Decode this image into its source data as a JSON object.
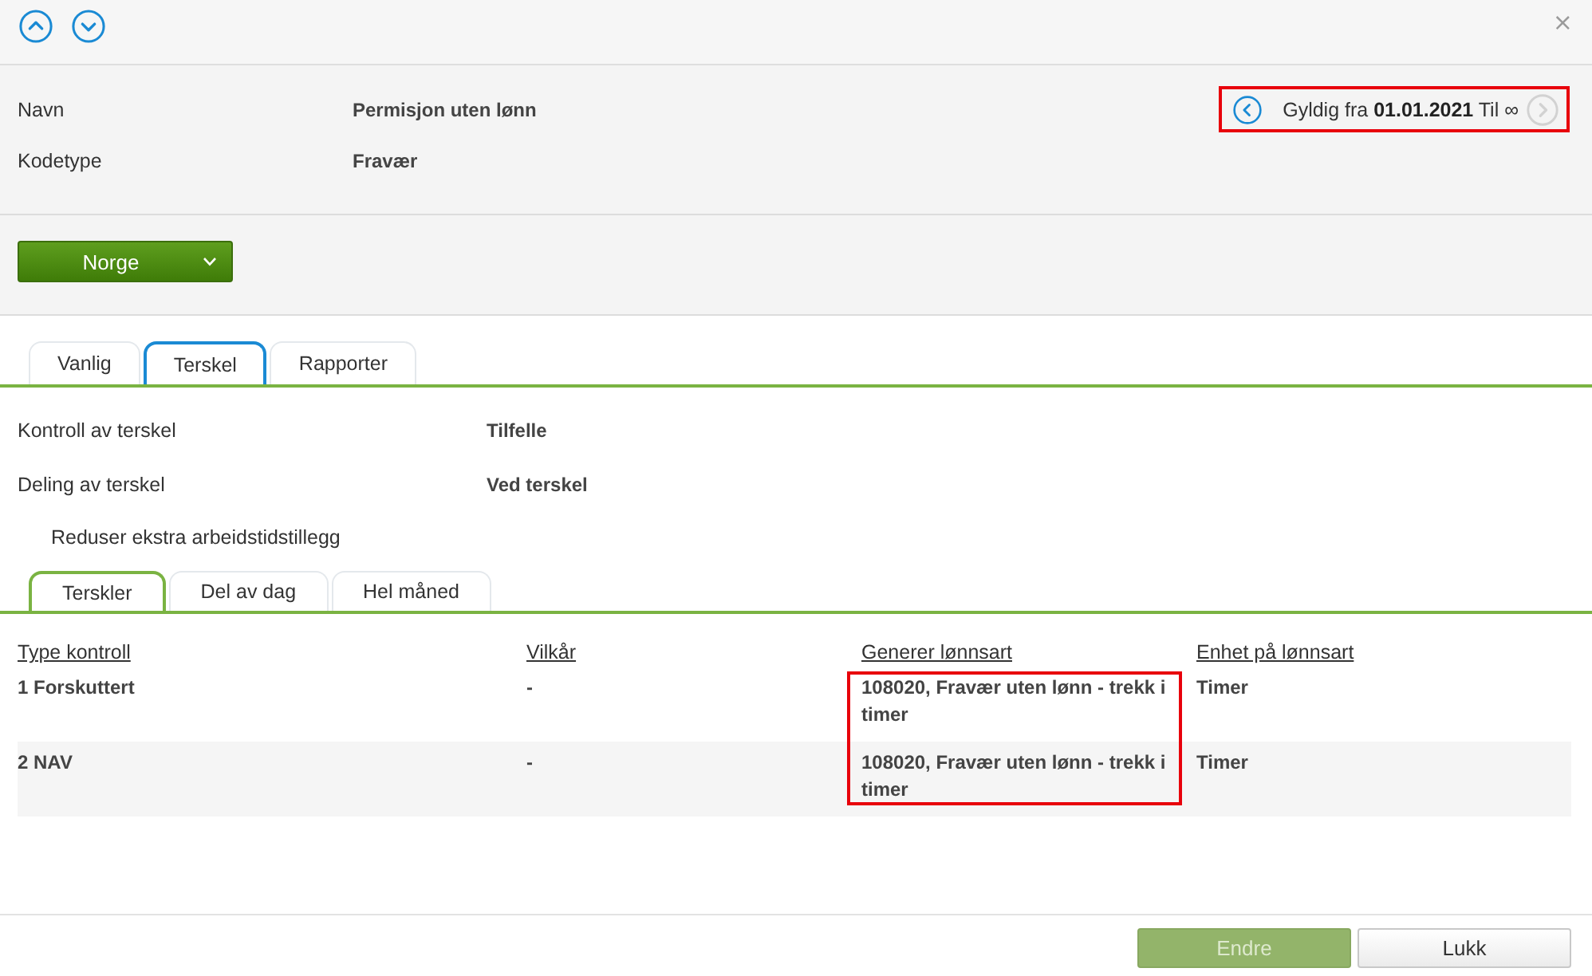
{
  "toolbar": {
    "close": "×"
  },
  "record": {
    "fields": [
      {
        "label": "Navn",
        "value": "Permisjon uten lønn"
      },
      {
        "label": "Kodetype",
        "value": "Fravær"
      }
    ],
    "validity": {
      "text": "Gyldig fra **01.01.2021** Til ∞",
      "prev": {
        "disabled": false
      },
      "next": {
        "disabled": true
      },
      "highlighted": true
    }
  },
  "country_select": {
    "value": "Norge"
  },
  "tabs": [
    {
      "label": "Vanlig",
      "selected": false
    },
    {
      "label": "Terskel",
      "selected": true
    },
    {
      "label": "Rapporter",
      "selected": false
    }
  ],
  "settings": [
    {
      "label": "Kontroll av terskel",
      "value": "Tilfelle"
    },
    {
      "label": "Deling av terskel",
      "value": "Ved terskel"
    }
  ],
  "note": "Reduser ekstra arbeidstidstillegg",
  "subtabs": [
    {
      "label": "Terskler",
      "selected": true
    },
    {
      "label": "Del av dag",
      "selected": false
    },
    {
      "label": "Hel måned",
      "selected": false
    }
  ],
  "table": {
    "columns": [
      {
        "label": "Type kontroll",
        "highlighted": false
      },
      {
        "label": "Vilkår",
        "highlighted": false
      },
      {
        "label": "Generer lønnsart",
        "highlighted": true
      },
      {
        "label": "Enhet på lønnsart",
        "highlighted": false
      }
    ],
    "rows": [
      {
        "cells": [
          "1 Forskuttert",
          "-",
          "108020, Fravær uten lønn - trekk i timer",
          "Timer"
        ]
      },
      {
        "cells": [
          "2 NAV",
          "-",
          "108020, Fravær uten lønn - trekk i timer",
          "Timer"
        ]
      }
    ]
  },
  "footer_buttons": [
    {
      "label": "Endre",
      "kind": "primary",
      "disabled": true
    },
    {
      "label": "Lukk",
      "kind": "secondary",
      "disabled": false
    }
  ]
}
